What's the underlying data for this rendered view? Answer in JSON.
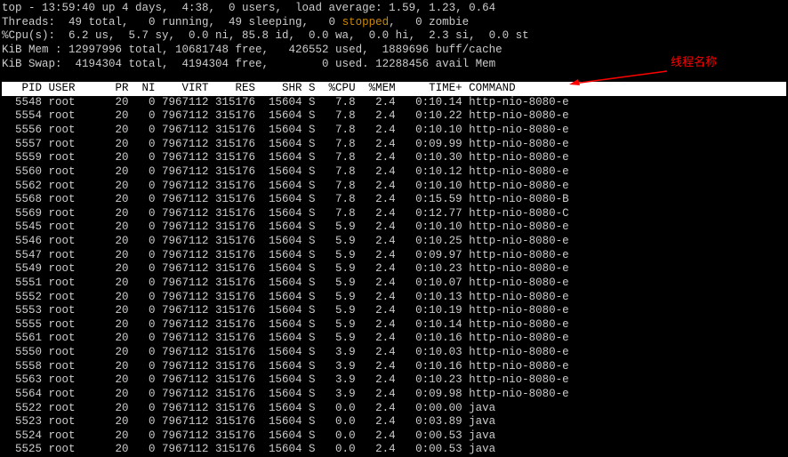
{
  "header": {
    "line1": "top - 13:59:40 up 4 days,  4:38,  0 users,  load average: 1.59, 1.23, 0.64",
    "line2_pre": "Threads:  49 total,   0 running,  49 sleeping,   0 ",
    "line2_stopped": "stopped",
    "line2_post": ",   0 zombie",
    "line3": "%Cpu(s):  6.2 us,  5.7 sy,  0.0 ni, 85.8 id,  0.0 wa,  0.0 hi,  2.3 si,  0.0 st",
    "line4": "KiB Mem : 12997996 total, 10681748 free,   426552 used,  1889696 buff/cache",
    "line5": "KiB Swap:  4194304 total,  4194304 free,        0 used. 12288456 avail Mem"
  },
  "annotation": "线程名称",
  "columns": "   PID USER      PR  NI    VIRT    RES    SHR S  %CPU  %MEM     TIME+ COMMAND                                                 ",
  "rows": [
    {
      "pid": "5548",
      "user": "root",
      "pr": "20",
      "ni": "0",
      "virt": "7967112",
      "res": "315176",
      "shr": "15604",
      "s": "S",
      "cpu": "7.8",
      "mem": "2.4",
      "time": "0:10.14",
      "cmd": "http-nio-8080-e"
    },
    {
      "pid": "5554",
      "user": "root",
      "pr": "20",
      "ni": "0",
      "virt": "7967112",
      "res": "315176",
      "shr": "15604",
      "s": "S",
      "cpu": "7.8",
      "mem": "2.4",
      "time": "0:10.22",
      "cmd": "http-nio-8080-e"
    },
    {
      "pid": "5556",
      "user": "root",
      "pr": "20",
      "ni": "0",
      "virt": "7967112",
      "res": "315176",
      "shr": "15604",
      "s": "S",
      "cpu": "7.8",
      "mem": "2.4",
      "time": "0:10.10",
      "cmd": "http-nio-8080-e"
    },
    {
      "pid": "5557",
      "user": "root",
      "pr": "20",
      "ni": "0",
      "virt": "7967112",
      "res": "315176",
      "shr": "15604",
      "s": "S",
      "cpu": "7.8",
      "mem": "2.4",
      "time": "0:09.99",
      "cmd": "http-nio-8080-e"
    },
    {
      "pid": "5559",
      "user": "root",
      "pr": "20",
      "ni": "0",
      "virt": "7967112",
      "res": "315176",
      "shr": "15604",
      "s": "S",
      "cpu": "7.8",
      "mem": "2.4",
      "time": "0:10.30",
      "cmd": "http-nio-8080-e"
    },
    {
      "pid": "5560",
      "user": "root",
      "pr": "20",
      "ni": "0",
      "virt": "7967112",
      "res": "315176",
      "shr": "15604",
      "s": "S",
      "cpu": "7.8",
      "mem": "2.4",
      "time": "0:10.12",
      "cmd": "http-nio-8080-e"
    },
    {
      "pid": "5562",
      "user": "root",
      "pr": "20",
      "ni": "0",
      "virt": "7967112",
      "res": "315176",
      "shr": "15604",
      "s": "S",
      "cpu": "7.8",
      "mem": "2.4",
      "time": "0:10.10",
      "cmd": "http-nio-8080-e"
    },
    {
      "pid": "5568",
      "user": "root",
      "pr": "20",
      "ni": "0",
      "virt": "7967112",
      "res": "315176",
      "shr": "15604",
      "s": "S",
      "cpu": "7.8",
      "mem": "2.4",
      "time": "0:15.59",
      "cmd": "http-nio-8080-B"
    },
    {
      "pid": "5569",
      "user": "root",
      "pr": "20",
      "ni": "0",
      "virt": "7967112",
      "res": "315176",
      "shr": "15604",
      "s": "S",
      "cpu": "7.8",
      "mem": "2.4",
      "time": "0:12.77",
      "cmd": "http-nio-8080-C"
    },
    {
      "pid": "5545",
      "user": "root",
      "pr": "20",
      "ni": "0",
      "virt": "7967112",
      "res": "315176",
      "shr": "15604",
      "s": "S",
      "cpu": "5.9",
      "mem": "2.4",
      "time": "0:10.10",
      "cmd": "http-nio-8080-e"
    },
    {
      "pid": "5546",
      "user": "root",
      "pr": "20",
      "ni": "0",
      "virt": "7967112",
      "res": "315176",
      "shr": "15604",
      "s": "S",
      "cpu": "5.9",
      "mem": "2.4",
      "time": "0:10.25",
      "cmd": "http-nio-8080-e"
    },
    {
      "pid": "5547",
      "user": "root",
      "pr": "20",
      "ni": "0",
      "virt": "7967112",
      "res": "315176",
      "shr": "15604",
      "s": "S",
      "cpu": "5.9",
      "mem": "2.4",
      "time": "0:09.97",
      "cmd": "http-nio-8080-e"
    },
    {
      "pid": "5549",
      "user": "root",
      "pr": "20",
      "ni": "0",
      "virt": "7967112",
      "res": "315176",
      "shr": "15604",
      "s": "S",
      "cpu": "5.9",
      "mem": "2.4",
      "time": "0:10.23",
      "cmd": "http-nio-8080-e"
    },
    {
      "pid": "5551",
      "user": "root",
      "pr": "20",
      "ni": "0",
      "virt": "7967112",
      "res": "315176",
      "shr": "15604",
      "s": "S",
      "cpu": "5.9",
      "mem": "2.4",
      "time": "0:10.07",
      "cmd": "http-nio-8080-e"
    },
    {
      "pid": "5552",
      "user": "root",
      "pr": "20",
      "ni": "0",
      "virt": "7967112",
      "res": "315176",
      "shr": "15604",
      "s": "S",
      "cpu": "5.9",
      "mem": "2.4",
      "time": "0:10.13",
      "cmd": "http-nio-8080-e"
    },
    {
      "pid": "5553",
      "user": "root",
      "pr": "20",
      "ni": "0",
      "virt": "7967112",
      "res": "315176",
      "shr": "15604",
      "s": "S",
      "cpu": "5.9",
      "mem": "2.4",
      "time": "0:10.19",
      "cmd": "http-nio-8080-e"
    },
    {
      "pid": "5555",
      "user": "root",
      "pr": "20",
      "ni": "0",
      "virt": "7967112",
      "res": "315176",
      "shr": "15604",
      "s": "S",
      "cpu": "5.9",
      "mem": "2.4",
      "time": "0:10.14",
      "cmd": "http-nio-8080-e"
    },
    {
      "pid": "5561",
      "user": "root",
      "pr": "20",
      "ni": "0",
      "virt": "7967112",
      "res": "315176",
      "shr": "15604",
      "s": "S",
      "cpu": "5.9",
      "mem": "2.4",
      "time": "0:10.16",
      "cmd": "http-nio-8080-e"
    },
    {
      "pid": "5550",
      "user": "root",
      "pr": "20",
      "ni": "0",
      "virt": "7967112",
      "res": "315176",
      "shr": "15604",
      "s": "S",
      "cpu": "3.9",
      "mem": "2.4",
      "time": "0:10.03",
      "cmd": "http-nio-8080-e"
    },
    {
      "pid": "5558",
      "user": "root",
      "pr": "20",
      "ni": "0",
      "virt": "7967112",
      "res": "315176",
      "shr": "15604",
      "s": "S",
      "cpu": "3.9",
      "mem": "2.4",
      "time": "0:10.16",
      "cmd": "http-nio-8080-e"
    },
    {
      "pid": "5563",
      "user": "root",
      "pr": "20",
      "ni": "0",
      "virt": "7967112",
      "res": "315176",
      "shr": "15604",
      "s": "S",
      "cpu": "3.9",
      "mem": "2.4",
      "time": "0:10.23",
      "cmd": "http-nio-8080-e"
    },
    {
      "pid": "5564",
      "user": "root",
      "pr": "20",
      "ni": "0",
      "virt": "7967112",
      "res": "315176",
      "shr": "15604",
      "s": "S",
      "cpu": "3.9",
      "mem": "2.4",
      "time": "0:09.98",
      "cmd": "http-nio-8080-e"
    },
    {
      "pid": "5522",
      "user": "root",
      "pr": "20",
      "ni": "0",
      "virt": "7967112",
      "res": "315176",
      "shr": "15604",
      "s": "S",
      "cpu": "0.0",
      "mem": "2.4",
      "time": "0:00.00",
      "cmd": "java"
    },
    {
      "pid": "5523",
      "user": "root",
      "pr": "20",
      "ni": "0",
      "virt": "7967112",
      "res": "315176",
      "shr": "15604",
      "s": "S",
      "cpu": "0.0",
      "mem": "2.4",
      "time": "0:03.89",
      "cmd": "java"
    },
    {
      "pid": "5524",
      "user": "root",
      "pr": "20",
      "ni": "0",
      "virt": "7967112",
      "res": "315176",
      "shr": "15604",
      "s": "S",
      "cpu": "0.0",
      "mem": "2.4",
      "time": "0:00.53",
      "cmd": "java"
    },
    {
      "pid": "5525",
      "user": "root",
      "pr": "20",
      "ni": "0",
      "virt": "7967112",
      "res": "315176",
      "shr": "15604",
      "s": "S",
      "cpu": "0.0",
      "mem": "2.4",
      "time": "0:00.53",
      "cmd": "java"
    }
  ]
}
